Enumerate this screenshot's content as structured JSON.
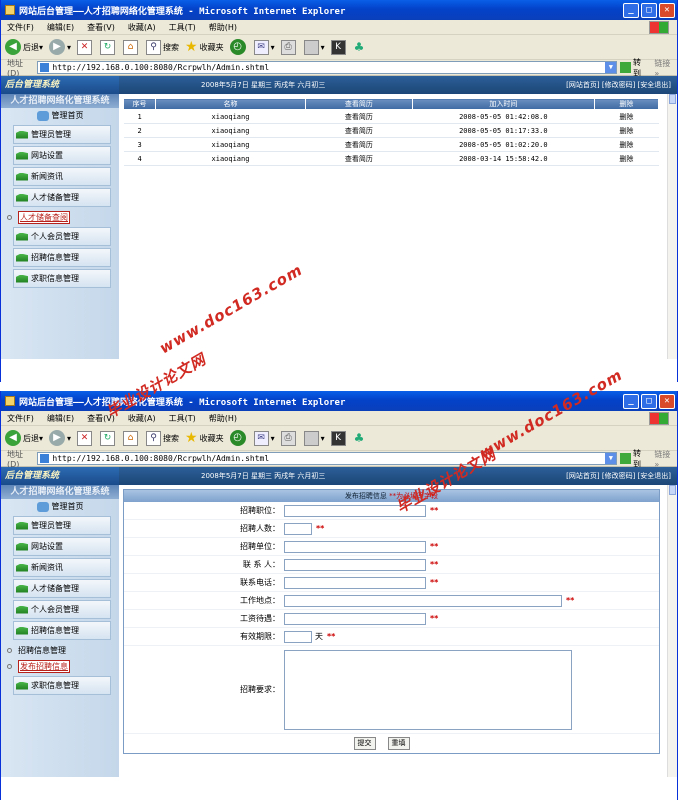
{
  "window1": {
    "title": "网站后台管理——人才招聘网络化管理系统 - Microsoft Internet Explorer",
    "menu": [
      "文件(F)",
      "编辑(E)",
      "查看(V)",
      "收藏(A)",
      "工具(T)",
      "帮助(H)"
    ],
    "toolbar": {
      "back": "后退",
      "search": "搜索",
      "favorites": "收藏夹"
    },
    "address_label": "地址(D)",
    "address_value": "http://192.168.0.100:8080/Rcrpwlh/Admin.shtml",
    "go_label": "转到",
    "links_label": "链接",
    "brand": "后台管理系统",
    "date": "2008年5月7日 星期三 丙戌年 六月初三",
    "header_links": "[网站首页] [修改密码] [安全退出]",
    "system_title": "人才招聘网络化管理系统",
    "sidebar": {
      "home": "管理首页",
      "items_top": [
        "管理员管理",
        "网站设置",
        "新闻资讯",
        "人才储备管理"
      ],
      "sub_selected": "人才储备查阅",
      "items_bottom": [
        "个人会员管理",
        "招聘信息管理",
        "求职信息管理"
      ]
    },
    "table": {
      "headers": [
        "序号",
        "名称",
        "查看简历",
        "加入时间",
        "删除"
      ],
      "rows": [
        {
          "no": "1",
          "name": "xiaoqiang",
          "view": "查看简历",
          "time": "2008-05-05 01:42:08.0",
          "del": "删除"
        },
        {
          "no": "2",
          "name": "xiaoqiang",
          "view": "查看简历",
          "time": "2008-05-05 01:17:33.0",
          "del": "删除"
        },
        {
          "no": "3",
          "name": "xiaoqiang",
          "view": "查看简历",
          "time": "2008-05-05 01:02:20.0",
          "del": "删除"
        },
        {
          "no": "4",
          "name": "xiaoqiang",
          "view": "查看简历",
          "time": "2008-03-14 15:58:42.0",
          "del": "删除"
        }
      ]
    }
  },
  "window2": {
    "title": "网站后台管理——人才招聘网络化管理系统 - Microsoft Internet Explorer",
    "sidebar": {
      "items_top": [
        "管理员管理",
        "网站设置",
        "新闻资讯",
        "人才储备管理",
        "个人会员管理",
        "招聘信息管理"
      ],
      "sub_plain": "招聘信息管理",
      "sub_selected": "发布招聘信息",
      "items_bottom": [
        "求职信息管理"
      ]
    },
    "form": {
      "header": "发布招聘信息",
      "header_required": "**为必填写字段",
      "fields": [
        "招聘职位：",
        "招聘人数：",
        "招聘单位：",
        "联 系 人：",
        "联系电话：",
        "工作地点：",
        "工资待遇：",
        "有效期限："
      ],
      "required_mark": "**",
      "days_unit": "天",
      "requirement_label": "招聘要求：",
      "submit": "提交",
      "reset": "重填"
    }
  },
  "watermarks": [
    "www.doc163.com",
    "毕业设计论文网"
  ]
}
